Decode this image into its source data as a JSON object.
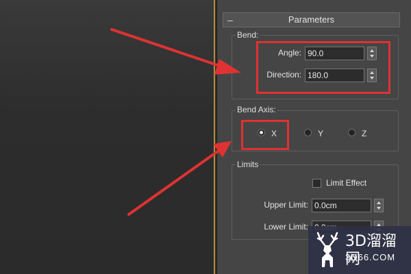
{
  "rollout": {
    "collapse_symbol": "–",
    "title": "Parameters"
  },
  "bend": {
    "group_label": "Bend:",
    "angle_label": "Angle:",
    "angle_value": "90.0",
    "direction_label": "Direction:",
    "direction_value": "180.0"
  },
  "bend_axis": {
    "group_label": "Bend Axis:",
    "options": [
      {
        "label": "X",
        "selected": true
      },
      {
        "label": "Y",
        "selected": false
      },
      {
        "label": "Z",
        "selected": false
      }
    ]
  },
  "limits": {
    "group_label": "Limits",
    "limit_effect_label": "Limit Effect",
    "limit_effect_checked": false,
    "upper_label": "Upper Limit:",
    "upper_value": "0.0cm",
    "lower_label": "Lower Limit:",
    "lower_value": "0.0cm"
  },
  "watermark": {
    "main": "3D溜溜网",
    "sub": "3D66.COM",
    "icon": "deer-logo-icon"
  },
  "colors": {
    "highlight": "#e03232",
    "panel_bg": "#454545",
    "field_bg": "#2c2c2c",
    "viewport_divider": "#b98d35"
  }
}
